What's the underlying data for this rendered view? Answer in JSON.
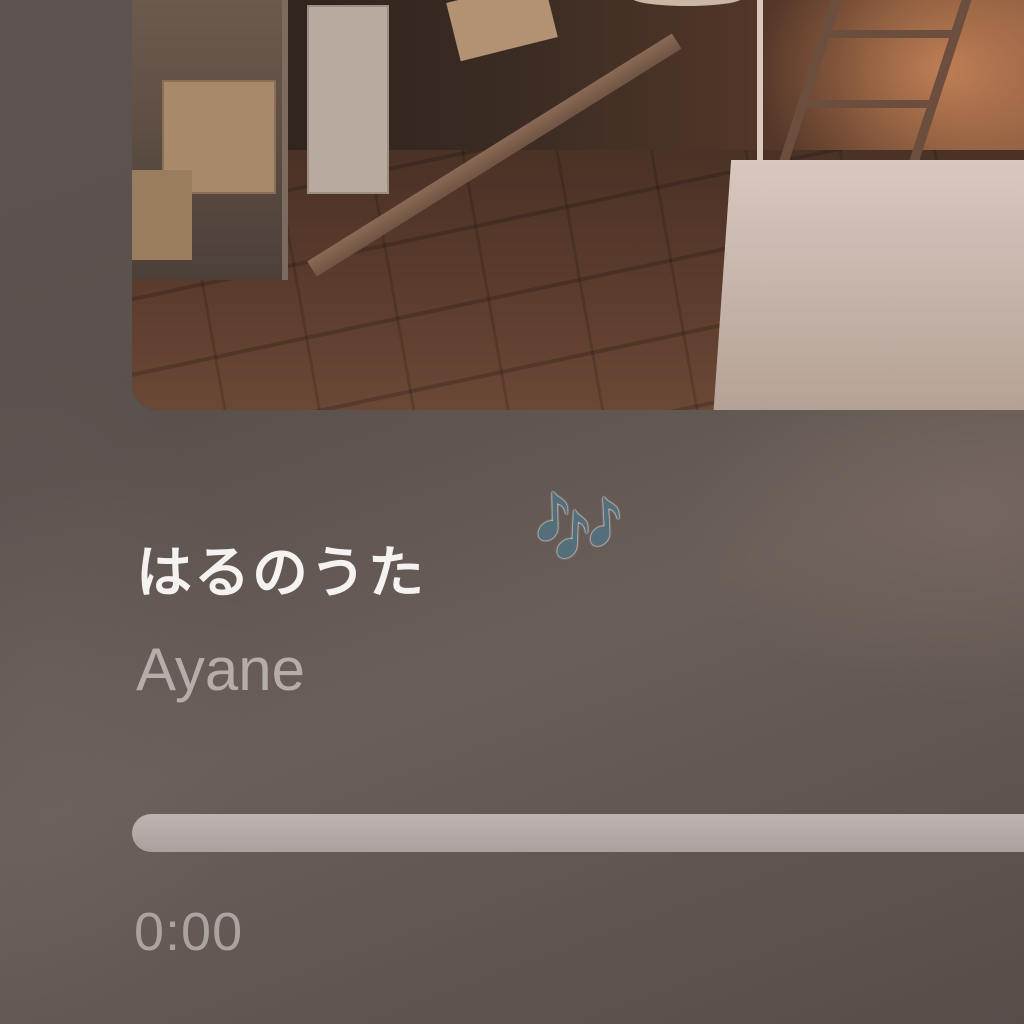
{
  "now_playing": {
    "title": "はるのうた",
    "title_decoration": "🎶",
    "artist": "Ayane",
    "elapsed": "0:00",
    "progress_fraction": 0.0
  },
  "artwork": {
    "icon": "album-artwork-image"
  },
  "colors": {
    "background": "#5c5451",
    "title": "#f5f3f2",
    "artist": "#b5adaa",
    "progress_track": "#bdb4b1",
    "elapsed": "#aba3a0",
    "notes": "#3ea8f0"
  }
}
